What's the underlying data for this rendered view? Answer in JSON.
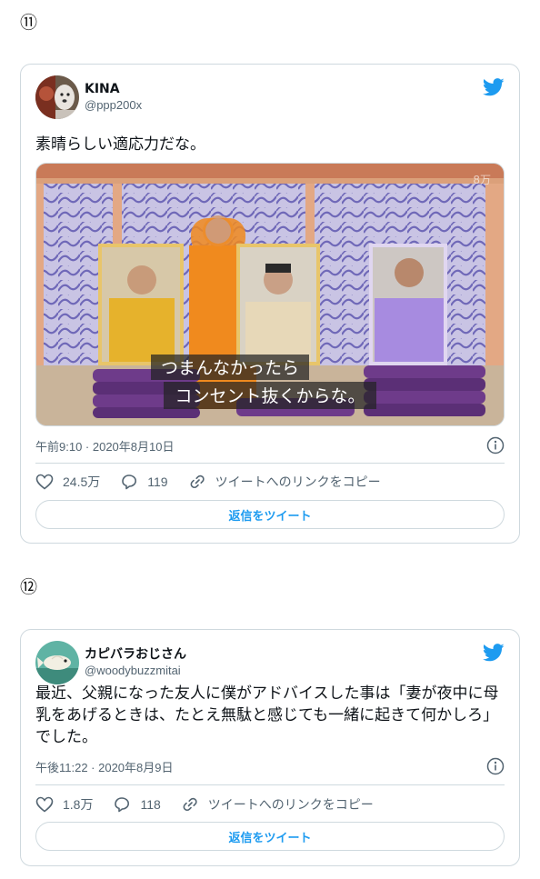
{
  "sections": [
    {
      "number": "⑪",
      "tweet": {
        "display_name": "KINA",
        "handle": "@ppp200x",
        "text": "素晴らしい適応力だな。",
        "media": {
          "subtitle_line1": "つまんなかったら",
          "subtitle_line2": "コンセント抜くからな。",
          "watermark": "8万"
        },
        "timestamp": "午前9:10 · 2020年8月10日",
        "likes": "24.5万",
        "replies": "119",
        "copy_link_label": "ツイートへのリンクをコピー",
        "reply_button_label": "返信をツイート"
      }
    },
    {
      "number": "⑫",
      "tweet": {
        "display_name": "カピバラおじさん",
        "handle": "@woodybuzzmitai",
        "text": "最近、父親になった友人に僕がアドバイスした事は「妻が夜中に母乳をあげるときは、たとえ無駄と感じても一緒に起きて何かしろ」でした。",
        "timestamp": "午後11:22 · 2020年8月9日",
        "likes": "1.8万",
        "replies": "118",
        "copy_link_label": "ツイートへのリンクをコピー",
        "reply_button_label": "返信をツイート"
      }
    }
  ],
  "colors": {
    "twitter_blue": "#1d9bf0",
    "border": "#cfd9de",
    "muted": "#536471"
  },
  "icons": [
    "twitter-bird-icon",
    "info-icon",
    "heart-icon",
    "reply-bubble-icon",
    "link-icon"
  ]
}
